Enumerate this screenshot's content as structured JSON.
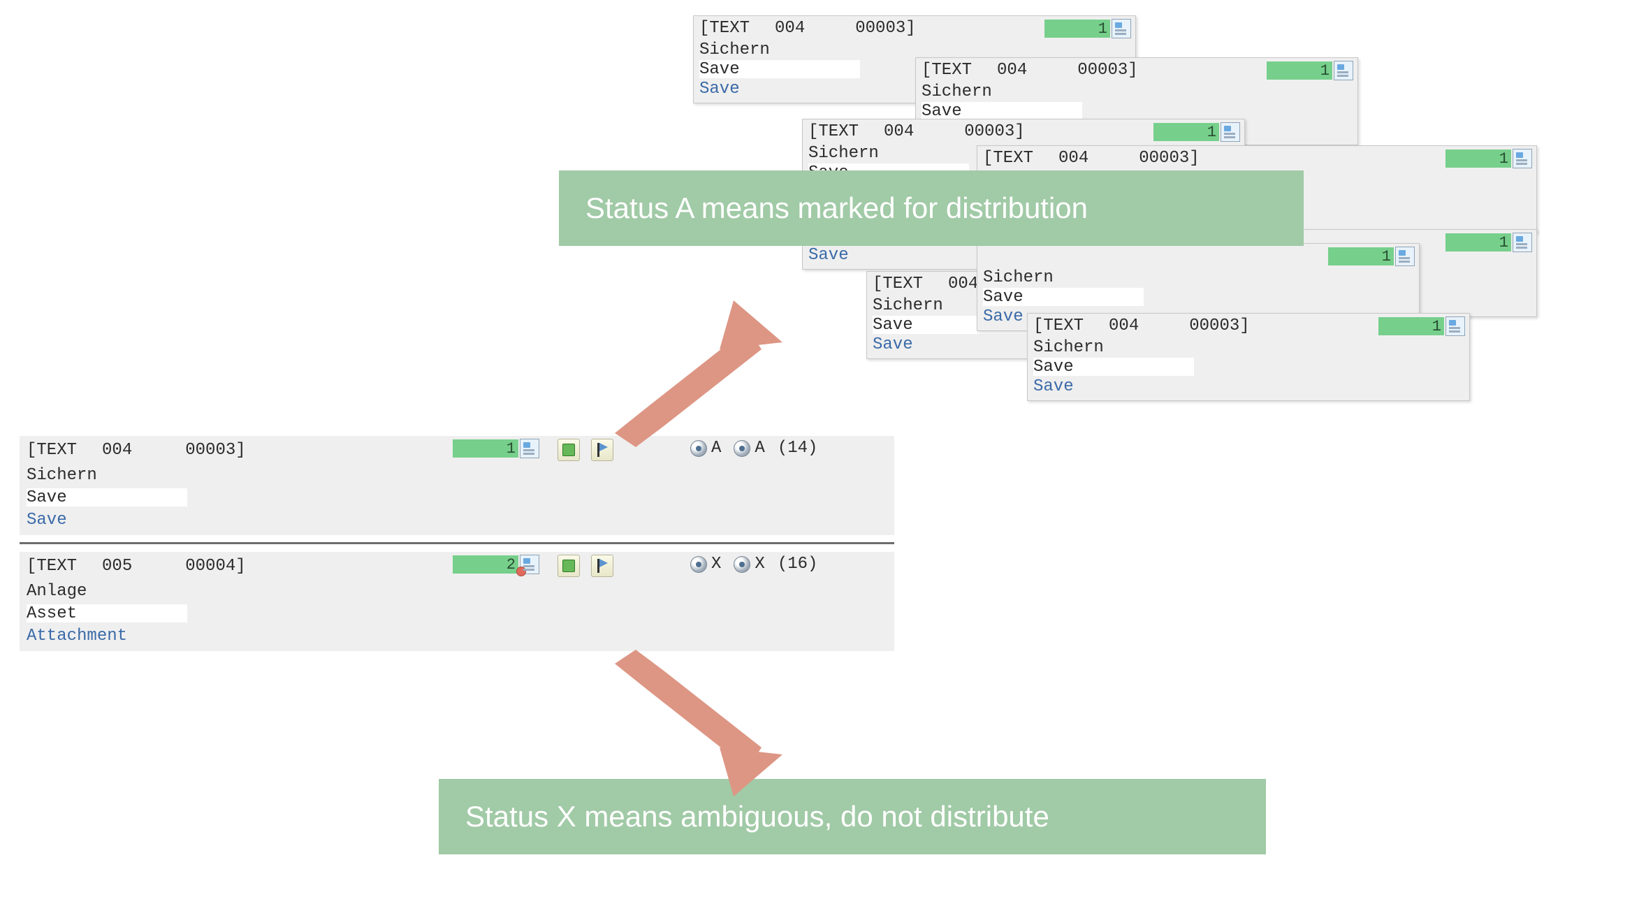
{
  "banners": {
    "statusA": "Status A means marked for distribution",
    "statusX": "Status X means ambiguous, do not distribute"
  },
  "tile": {
    "header_parts": [
      "[TEXT",
      "004",
      "00003]"
    ],
    "rows": {
      "sichern": "Sichern",
      "save_display": "Save",
      "save_link": "Save"
    },
    "indicator_count": "1"
  },
  "main": {
    "entryA": {
      "header_parts": [
        "[TEXT",
        "004",
        "00003]"
      ],
      "rows": {
        "de": "Sichern",
        "en": "Save",
        "link": "Save"
      },
      "indicator_count": "1",
      "status_left": "A",
      "status_right": "A",
      "count": "(14)"
    },
    "entryX": {
      "header_parts": [
        "[TEXT",
        "005",
        "00004]"
      ],
      "rows": {
        "de": "Anlage",
        "en": "Asset",
        "link": "Attachment"
      },
      "indicator_count": "2",
      "status_left": "X",
      "status_right": "X",
      "count": "(16)"
    }
  }
}
